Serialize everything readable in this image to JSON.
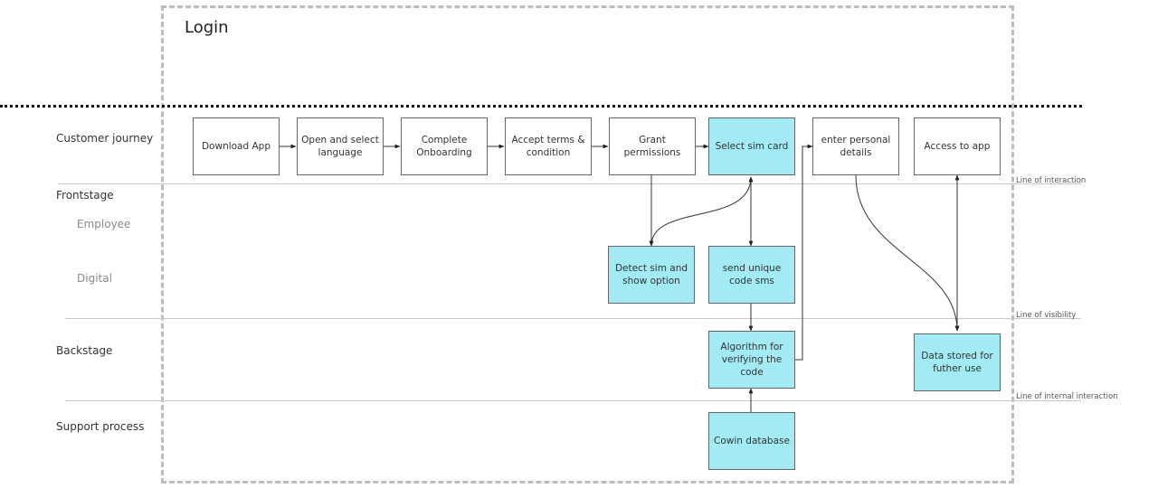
{
  "title": "Login",
  "lanes": {
    "customer_journey": "Customer journey",
    "frontstage": "Frontstage",
    "employee": "Employee",
    "digital": "Digital",
    "backstage": "Backstage",
    "support_process": "Support process"
  },
  "lines": {
    "interaction": "Line of interaction",
    "visibility": "Line of visibility",
    "internal_interaction": "Line of internal interaction"
  },
  "boxes": {
    "download_app": "Download App",
    "open_select_language": "Open and select language",
    "complete_onboarding": "Complete Onboarding",
    "accept_terms": "Accept terms & condition",
    "grant_permissions": "Grant permissions",
    "select_sim_card": "Select sim card",
    "enter_personal_details": "enter personal details",
    "access_to_app": "Access to app",
    "detect_sim": "Detect sim and show option",
    "send_unique_code": "send unique code sms",
    "algorithm_verify": "Algorithm for verifying the code",
    "data_stored": "Data stored for futher use",
    "cowin_database": "Cowin database"
  },
  "colors": {
    "highlight": "#a2ebf4",
    "border": "#666666",
    "frame": "#bdbdbd"
  }
}
